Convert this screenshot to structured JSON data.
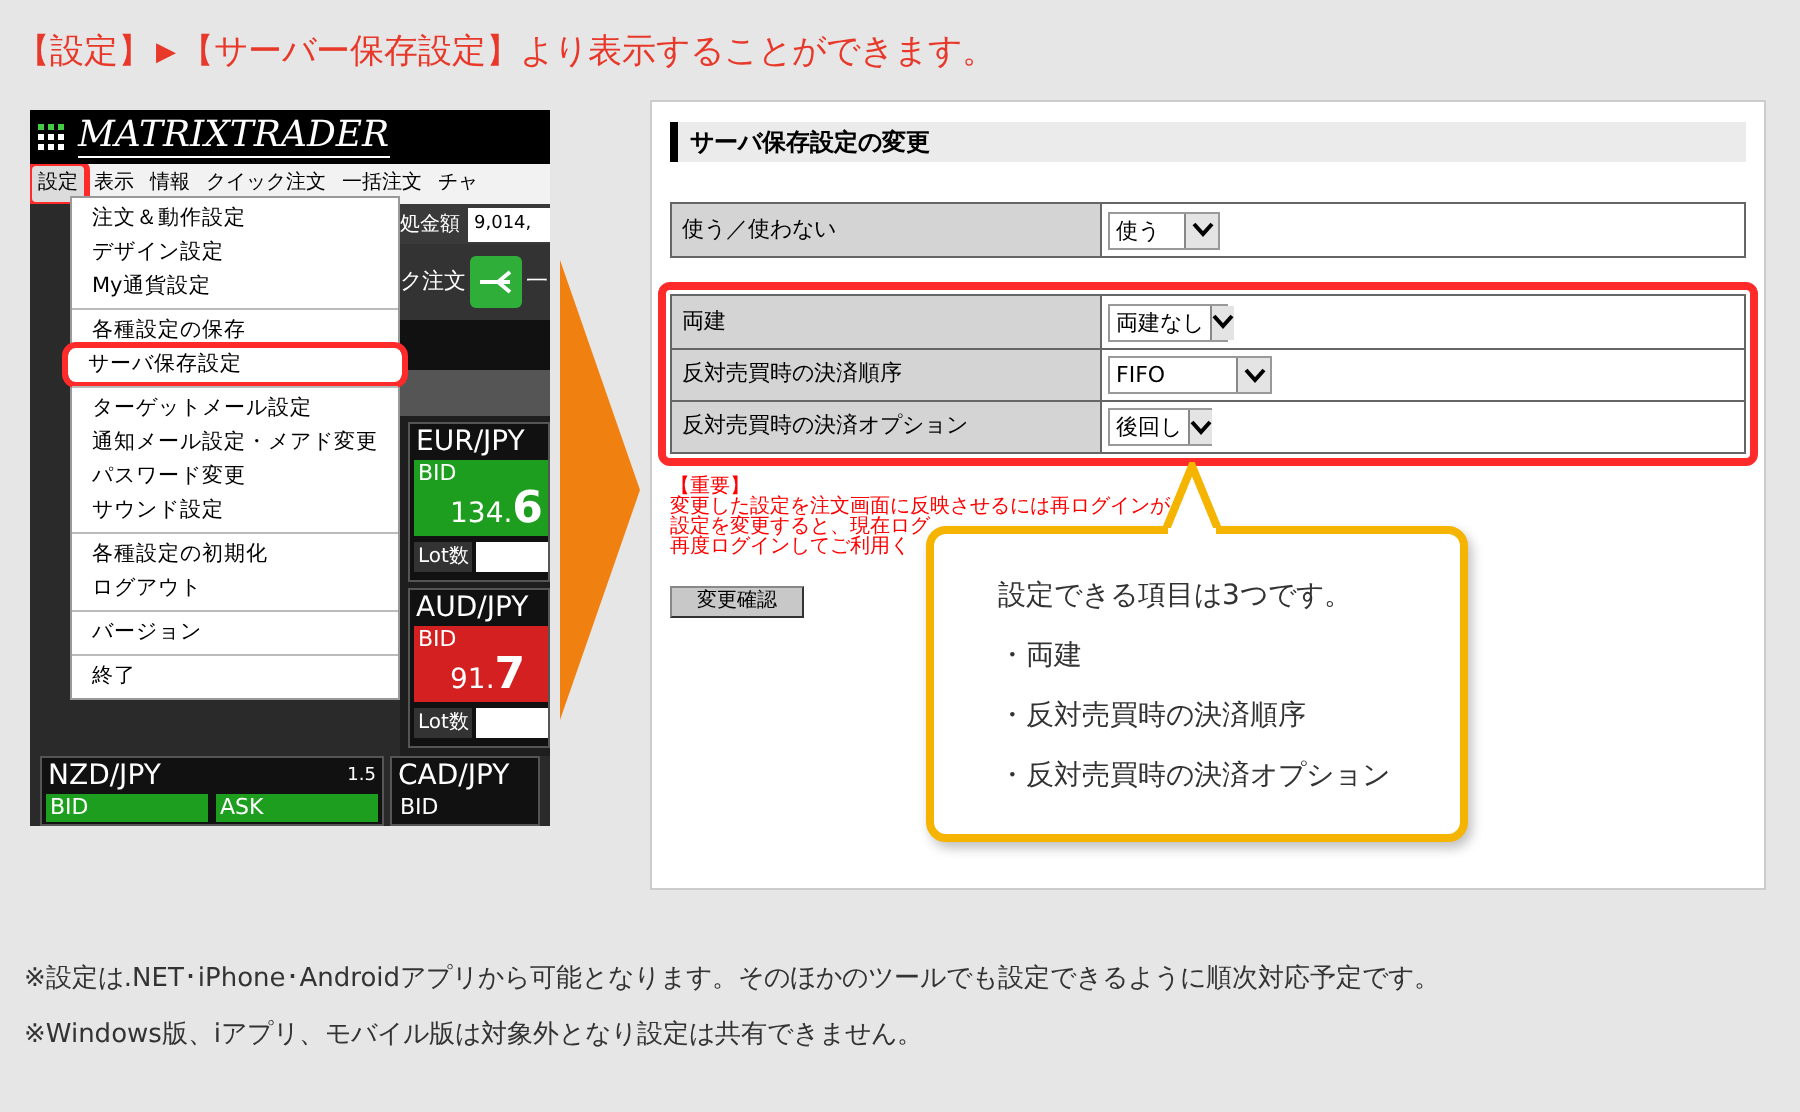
{
  "heading": {
    "prefix": "【設定】",
    "arrow": "▶",
    "rest": "【サーバー保存設定】より表示することができます。"
  },
  "app": {
    "logo": "MATRIXTRADER",
    "menu": [
      {
        "label": "設定",
        "selected": true
      },
      {
        "label": "表示",
        "selected": false
      },
      {
        "label": "情報",
        "selected": false
      },
      {
        "label": "クイック注文",
        "selected": false
      },
      {
        "label": "一括注文",
        "selected": false
      },
      {
        "label": "チャ",
        "selected": false
      }
    ],
    "dropdown": [
      [
        {
          "label": "注文＆動作設定",
          "highlighted": false
        },
        {
          "label": "デザイン設定",
          "highlighted": false
        },
        {
          "label": "My通貨設定",
          "highlighted": false
        }
      ],
      [
        {
          "label": "各種設定の保存",
          "highlighted": false
        },
        {
          "label": "サーバ保存設定",
          "highlighted": true
        }
      ],
      [
        {
          "label": "ターゲットメール設定",
          "highlighted": false
        },
        {
          "label": "通知メール設定・メアド変更",
          "highlighted": false
        },
        {
          "label": "パスワード変更",
          "highlighted": false
        },
        {
          "label": "サウンド設定",
          "highlighted": false
        }
      ],
      [
        {
          "label": "各種設定の初期化",
          "highlighted": false
        },
        {
          "label": "ログアウト",
          "highlighted": false
        }
      ],
      [
        {
          "label": "バージョン",
          "highlighted": false
        }
      ],
      [
        {
          "label": "終了",
          "highlighted": false
        }
      ]
    ],
    "funds_label": "処金額",
    "funds_value": "9,014,",
    "order_label": "ク注文",
    "bulk_label": "一",
    "rate_cards": [
      {
        "pair": "EUR/JPY",
        "side": "BID",
        "price_small": "134.",
        "price_big": "6",
        "color": "#1e9e1e",
        "lot": "Lot数"
      },
      {
        "pair": "AUD/JPY",
        "side": "BID",
        "price_small": "91.",
        "price_big": "7",
        "color": "#d42020",
        "lot": "Lot数"
      }
    ],
    "bottom_cards": [
      {
        "pair": "NZD/JPY",
        "spread": "1.5",
        "sides": [
          "BID",
          "ASK"
        ]
      },
      {
        "pair": "CAD/JPY",
        "sides": [
          "BID"
        ]
      }
    ]
  },
  "panel": {
    "title": "サーバ保存設定の変更",
    "tables": [
      {
        "highlighted": false,
        "rows": [
          {
            "label": "使う／使わない",
            "value": "使う"
          }
        ]
      },
      {
        "highlighted": true,
        "rows": [
          {
            "label": "両建",
            "value": "両建なし"
          },
          {
            "label": "反対売買時の決済順序",
            "value": "FIFO"
          },
          {
            "label": "反対売買時の決済オプション",
            "value": "後回し"
          }
        ]
      }
    ],
    "notice": [
      "【重要】",
      "変更した設定を注文画面に反映させるには再ログインが",
      "設定を変更すると、現在ログ",
      "再度ログインしてご利用く"
    ],
    "button": "変更確認",
    "callout": {
      "title": "設定できる項目は3つです。",
      "items": [
        "・両建",
        "・反対売買時の決済順序",
        "・反対売買時の決済オプション"
      ]
    }
  },
  "notes": [
    "※設定は.NET･iPhone･Androidアプリから可能となります。そのほかのツールでも設定できるように順次対応予定です。",
    "※Windows版、iアプリ、モバイル版は対象外となり設定は共有できません。"
  ]
}
